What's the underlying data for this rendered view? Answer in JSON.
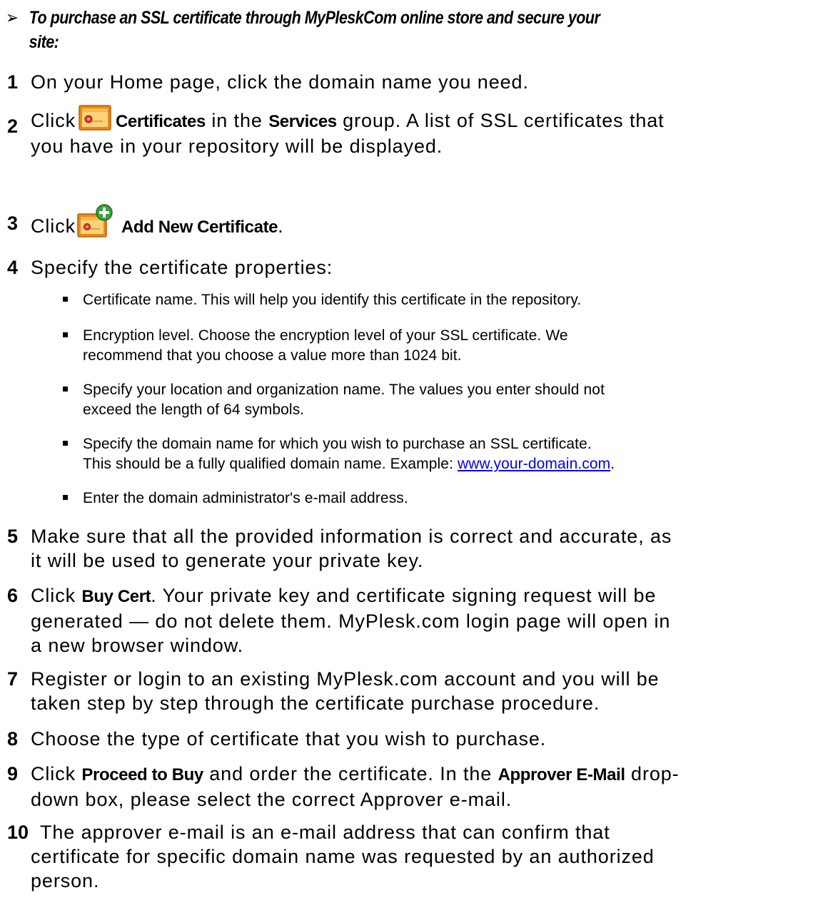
{
  "procedure_title": {
    "arrow": "➢",
    "line1": "To purchase an SSL certificate through MyPleskCom online store and secure your",
    "line2": "site:"
  },
  "steps": {
    "s1": {
      "num": "1",
      "text": "On your Home page, click the domain name you need."
    },
    "s2": {
      "num": "2",
      "click": "Click",
      "ui1": "Certificates",
      "mid": " in the ",
      "ui2": "Services",
      "line1_end": " group. A list of SSL certificates that",
      "line2": "you have in your repository will be displayed."
    },
    "s3": {
      "num": "3",
      "click": "Click",
      "ui": "Add New Certificate",
      "end": "."
    },
    "s4": {
      "num": "4",
      "text": "Specify the certificate properties:"
    },
    "s5": {
      "num": "5",
      "line1": "Make sure that all the provided information is correct and accurate, as",
      "line2": "it will be used to generate your private key."
    },
    "s6": {
      "num": "6",
      "click": "Click",
      "ui": "Buy Cert",
      "line1_end": ". Your private key and certificate signing request will be",
      "line2": "generated — do not delete them. MyPlesk.com login page will open in",
      "line3": "a new browser window."
    },
    "s7": {
      "num": "7",
      "line1": "Register or login to an existing MyPlesk.com account and you will be",
      "line2": "taken step by step through the certificate purchase procedure."
    },
    "s8": {
      "num": "8",
      "text": "Choose the type of certificate that you wish to purchase."
    },
    "s9": {
      "num": "9",
      "click": "Click",
      "ui1": "Proceed to Buy",
      "mid": " and order the certificate. In the ",
      "ui2": "Approver E-Mail",
      "line1_end": " drop-",
      "line2": "down box, please select the correct Approver e-mail."
    },
    "s10": {
      "num": "10",
      "line1": "The approver e-mail is an e-mail address that can confirm that",
      "line2": "certificate for specific domain name was requested by an authorized",
      "line3": "person."
    }
  },
  "bullets": {
    "b1": "Certificate name. This will help you identify this certificate in the repository.",
    "b2_line1": "Encryption level. Choose the encryption level of your SSL certificate. We",
    "b2_line2": "recommend that you choose a value more than 1024 bit.",
    "b3_line1": "Specify your location and organization name. The values you enter should not",
    "b3_line2": "exceed the length of 64 symbols.",
    "b4_line1": "Specify the domain name for which you wish to purchase an SSL certificate.",
    "b4_line2_pre": "This should be a fully qualified domain name. Example: ",
    "b4_link": "www.your-domain.com",
    "b4_line2_post": ".",
    "b5": "Enter the domain administrator's e-mail address."
  },
  "icons": {
    "certificates": "certificate-icon",
    "add_new_certificate": "add-certificate-icon"
  },
  "colors": {
    "link": "#0000ee",
    "icon_orange": "#f0a020",
    "icon_plus_green": "#3aa23a"
  }
}
